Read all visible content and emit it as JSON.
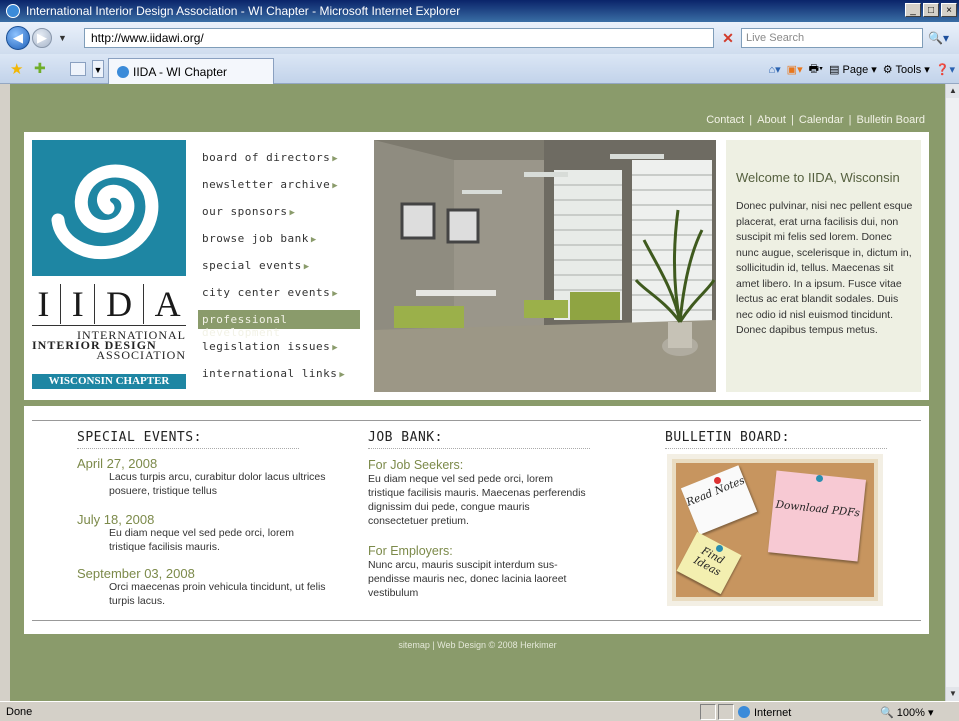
{
  "window": {
    "title": "International Interior Design Association - WI Chapter - Microsoft Internet Explorer"
  },
  "browser": {
    "url": "http://www.iidawi.org/",
    "search_placeholder": "Live Search",
    "tab_label": "IIDA - WI Chapter",
    "cmd": {
      "page": "Page",
      "tools": "Tools"
    },
    "status": "Done",
    "zone": "Internet",
    "zoom": "100%"
  },
  "site": {
    "toplinks": [
      "Contact",
      "About",
      "Calendar",
      "Bulletin Board"
    ],
    "logo": {
      "letters": [
        "I",
        "I",
        "D",
        "A"
      ],
      "line1": "INTERNATIONAL",
      "line2": "INTERIOR DESIGN",
      "line3": "ASSOCIATION",
      "chapter": "WISCONSIN CHAPTER"
    },
    "menu": [
      {
        "label": "board of directors",
        "active": false
      },
      {
        "label": "newsletter archive",
        "active": false
      },
      {
        "label": "our sponsors",
        "active": false
      },
      {
        "label": "browse job bank",
        "active": false
      },
      {
        "label": "special events",
        "active": false
      },
      {
        "label": "city center events",
        "active": false
      },
      {
        "label": "professional development",
        "active": true
      },
      {
        "label": "legislation issues",
        "active": false
      },
      {
        "label": "international links",
        "active": false
      }
    ],
    "welcome": {
      "title": "Welcome to IIDA, Wisconsin",
      "body": "Donec pulvinar, nisi nec pellent esque placerat, erat urna facilisis dui, non suscipit mi felis sed lorem. Donec nunc augue, scelerisque in, dictum in, sollicitudin id, tellus. Maecenas sit amet libero. In a ipsum. Fusce vitae lectus ac erat blandit sodales. Duis nec odio id nisl euismod tincidunt. Donec dapibus tempus metus."
    },
    "special_events": {
      "title": "SPECIAL EVENTS:",
      "items": [
        {
          "date": "April 27, 2008",
          "text": "Lacus turpis arcu, curabitur dolor lacus ultrices posuere, tristique tellus"
        },
        {
          "date": "July 18, 2008",
          "text": "Eu diam neque vel sed pede orci, lorem tristique facilisis mauris."
        },
        {
          "date": "September 03, 2008",
          "text": "Orci maecenas proin vehicula tincidunt, ut felis turpis lacus."
        }
      ]
    },
    "job_bank": {
      "title": "JOB BANK:",
      "seekers_title": "For Job Seekers:",
      "seekers_text": "Eu diam neque vel sed pede orci, lorem tristique facilisis mauris. Maecenas perferendis dignissim dui pede, congue mauris consectetuer pretium.",
      "employers_title": "For Employers:",
      "employers_text": "Nunc arcu, mauris suscipit interdum sus-pendisse mauris nec, donec lacinia laoreet vestibulum"
    },
    "bulletin": {
      "title": "BULLETIN BOARD:",
      "note_read": "Read Notes",
      "note_download": "Download PDFs",
      "note_find": "Find Ideas"
    },
    "footer": "sitemap  |  Web Design © 2008 Herkimer"
  },
  "colors": {
    "olive": "#8a9b6b",
    "teal": "#1e86a3",
    "date_green": "#7c8a4a"
  }
}
